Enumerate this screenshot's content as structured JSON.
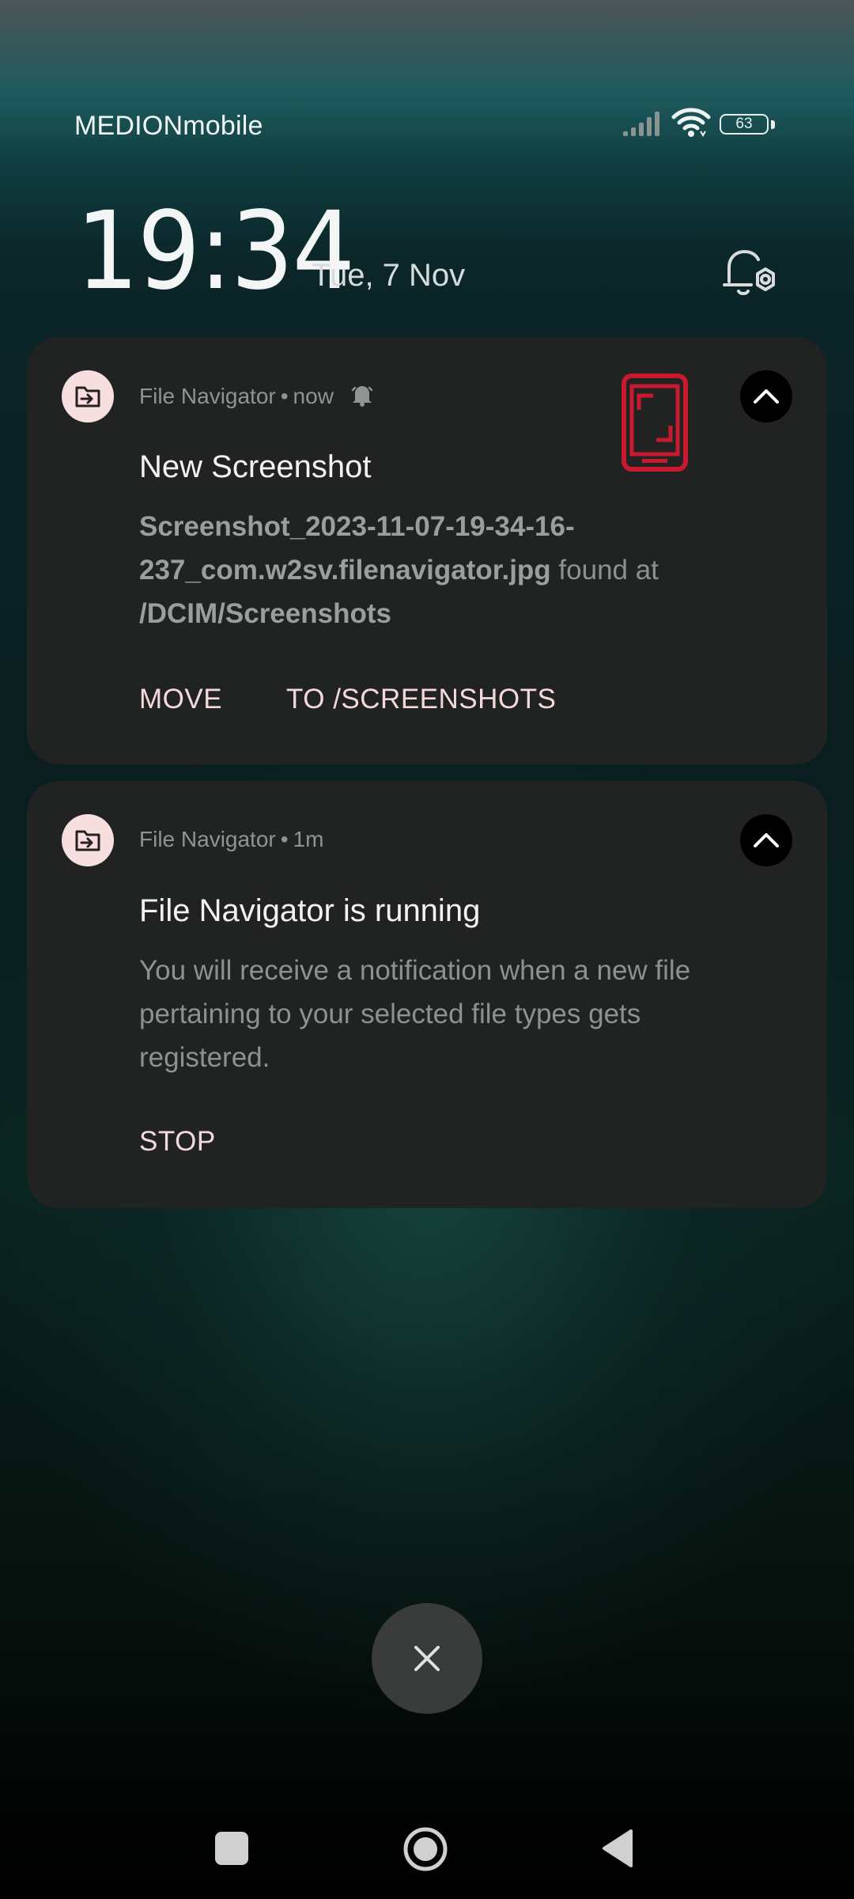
{
  "status_bar": {
    "carrier": "MEDIONmobile",
    "battery_level": "63",
    "signal_icon": "signal-bars-icon",
    "wifi_icon": "wifi-icon"
  },
  "lockscreen": {
    "time": "19:34",
    "date": "Tue, 7 Nov"
  },
  "notifications": [
    {
      "app_name": "File Navigator",
      "time": "now",
      "title": "New Screenshot",
      "body_filename": "Screenshot_2023-11-07-19-34-16-237_com.w2sv.filenavigator.jpg",
      "body_mid": " found at ",
      "body_path": "/DCIM/Screenshots",
      "actions": [
        "MOVE",
        "TO /SCREENSHOTS"
      ],
      "accent_color": "#c8192f"
    },
    {
      "app_name": "File Navigator",
      "time": "1m",
      "title": "File Navigator is running",
      "body": "You will receive a notification when a new file pertaining to your selected file types gets registered.",
      "actions": [
        "STOP"
      ]
    }
  ],
  "colors": {
    "action_text": "#f4d9dc",
    "app_icon_bg": "#f7dfe0",
    "card_bg": "#212323"
  }
}
